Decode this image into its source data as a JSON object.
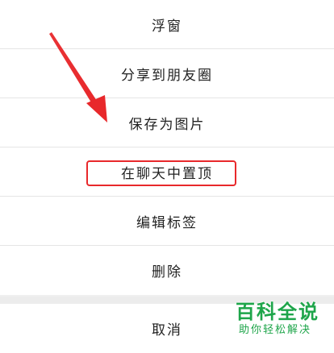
{
  "menu": {
    "items": [
      {
        "label": "浮窗"
      },
      {
        "label": "分享到朋友圈"
      },
      {
        "label": "保存为图片"
      },
      {
        "label": "在聊天中置顶"
      },
      {
        "label": "编辑标签"
      },
      {
        "label": "删除"
      }
    ],
    "cancel_label": "取消"
  },
  "annotation": {
    "highlight_color": "#e8282b",
    "arrow_color": "#e8282b",
    "highlighted_item": "在聊天中置顶"
  },
  "watermark": {
    "title": "百科全说",
    "subtitle": "助你轻松解决",
    "color": "#1ea54a"
  }
}
